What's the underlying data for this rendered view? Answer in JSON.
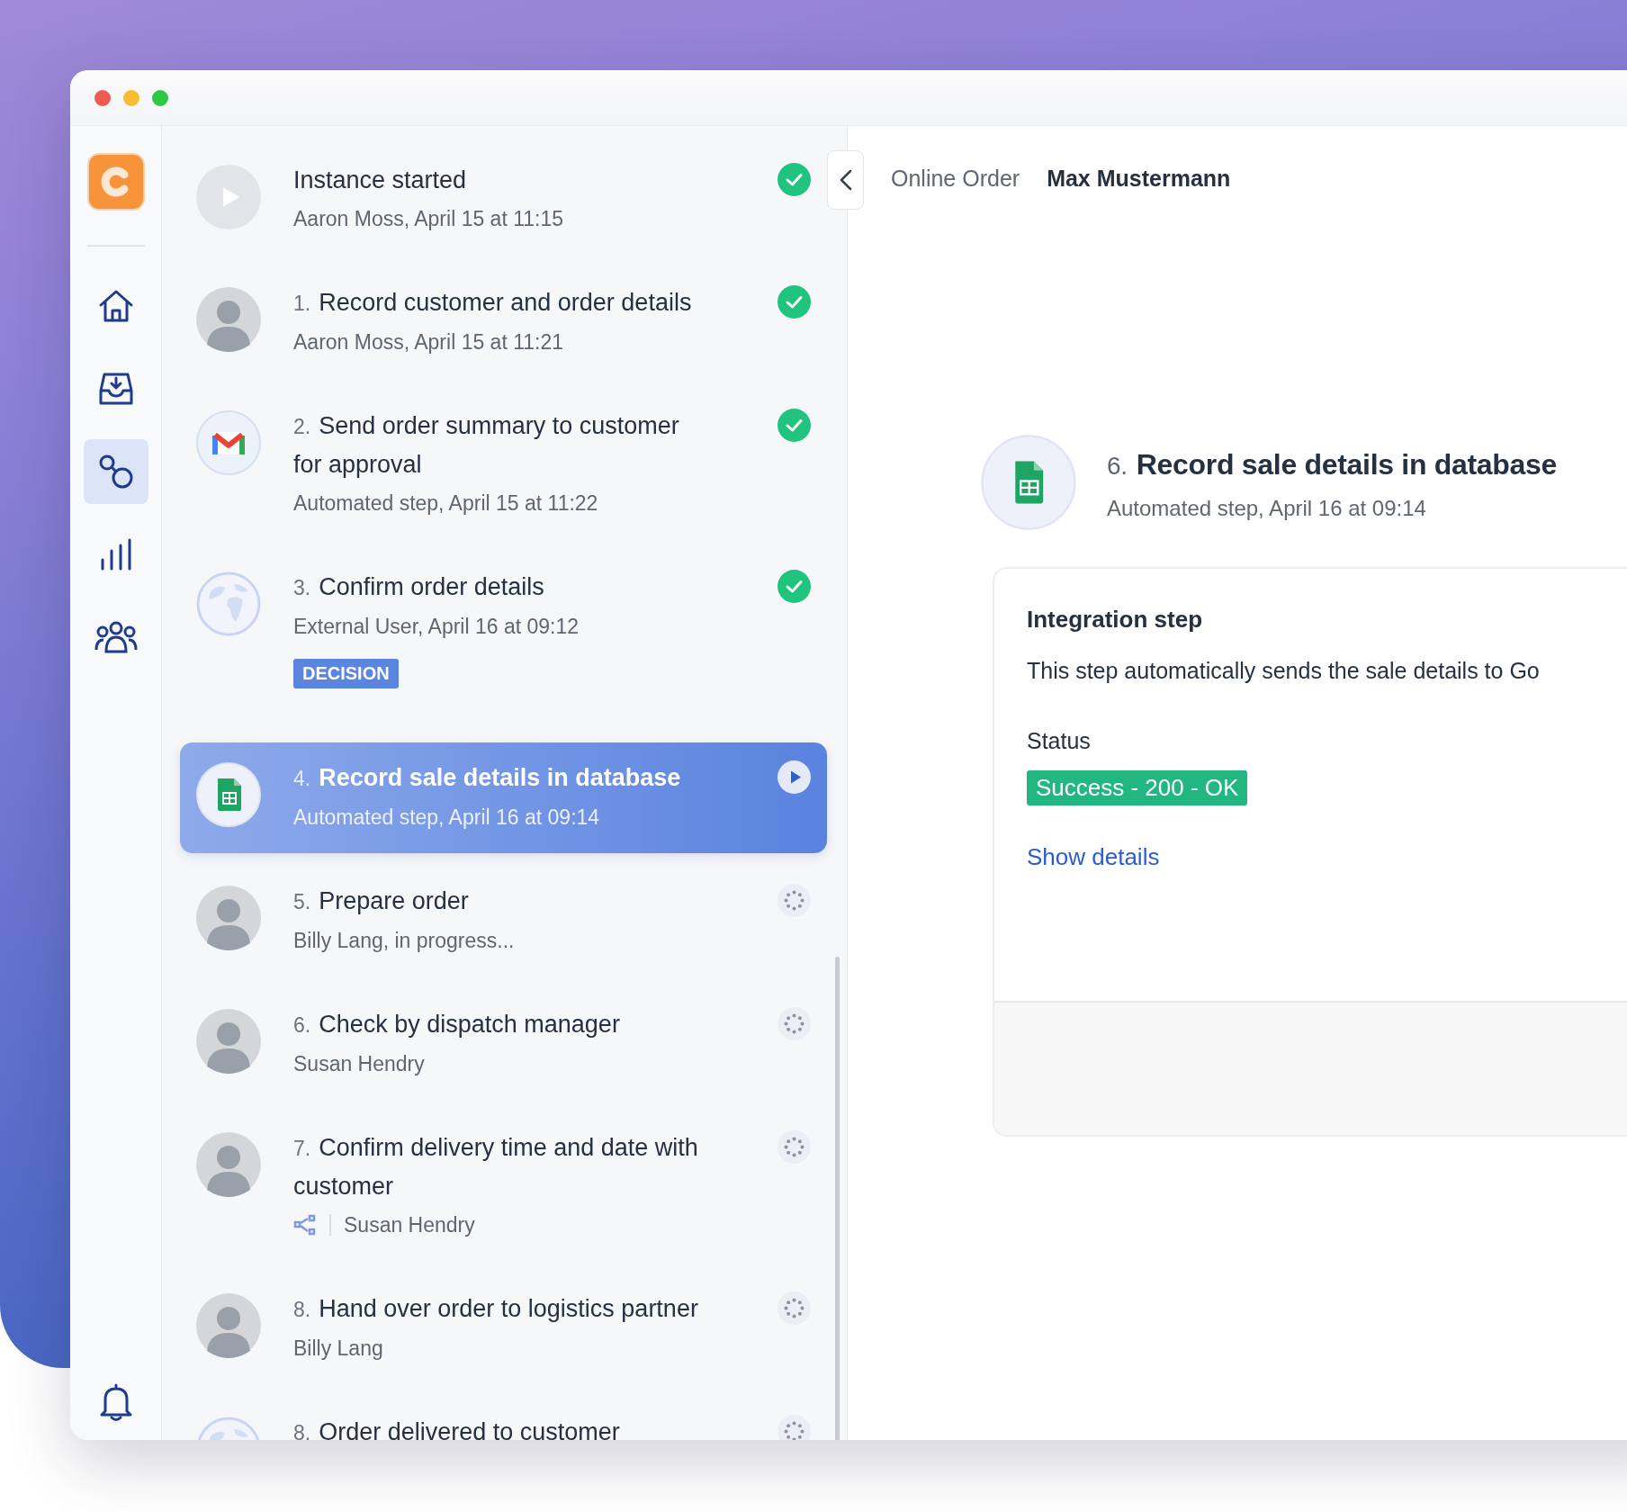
{
  "nav": {
    "items": [
      {
        "kind": "home",
        "selected": false
      },
      {
        "kind": "inbox",
        "selected": false
      },
      {
        "kind": "processes",
        "selected": true
      },
      {
        "kind": "reports",
        "selected": false
      },
      {
        "kind": "team",
        "selected": false
      }
    ]
  },
  "steps": [
    {
      "title": "Instance started",
      "subtitle": "Aaron Moss, April 15 at 11:15",
      "avatar": {
        "kind": "start"
      },
      "status": {
        "kind": "done"
      },
      "selected": false
    },
    {
      "number": "1.",
      "title": "Record customer and order details",
      "subtitle": "Aaron Moss, April 15 at 11:21",
      "avatar": {
        "kind": "person"
      },
      "status": {
        "kind": "done"
      },
      "selected": false
    },
    {
      "number": "2.",
      "title": "Send order summary to customer for approval",
      "subtitle": "Automated step, April 15 at 11:22",
      "avatar": {
        "kind": "mail"
      },
      "status": {
        "kind": "done"
      },
      "selected": false
    },
    {
      "number": "3.",
      "title": "Confirm order details",
      "subtitle": "External User, April 16 at 09:12",
      "avatar": {
        "kind": "globe"
      },
      "status": {
        "kind": "done"
      },
      "selected": false,
      "badge": "DECISION"
    },
    {
      "number": "4.",
      "title": "Record sale details in database",
      "subtitle": "Automated step, April 16 at 09:14",
      "avatar": {
        "kind": "sheet"
      },
      "status": {
        "kind": "running"
      },
      "selected": true
    },
    {
      "number": "5.",
      "title": "Prepare order",
      "subtitle": "Billy Lang, in progress...",
      "avatar": {
        "kind": "person"
      },
      "status": {
        "kind": "pending"
      },
      "selected": false
    },
    {
      "number": "6.",
      "title": "Check by dispatch manager",
      "subtitle": "Susan Hendry",
      "avatar": {
        "kind": "person"
      },
      "status": {
        "kind": "pending"
      },
      "selected": false
    },
    {
      "number": "7.",
      "title": "Confirm delivery time and date with customer",
      "subtitle": "Susan Hendry",
      "avatar": {
        "kind": "person"
      },
      "status": {
        "kind": "pending"
      },
      "selected": false,
      "subprocess": true
    },
    {
      "number": "8.",
      "title": "Hand over order to logistics partner",
      "subtitle": "Billy Lang",
      "avatar": {
        "kind": "person"
      },
      "status": {
        "kind": "pending"
      },
      "selected": false
    },
    {
      "number": "8.",
      "title": "Order delivered to customer",
      "avatar": {
        "kind": "globe"
      },
      "status": {
        "kind": "pending"
      },
      "selected": false
    }
  ],
  "breadcrumb": [
    {
      "label": "Online Order",
      "current": false
    },
    {
      "label": "Max Mustermann",
      "current": true
    }
  ],
  "detail": {
    "number": "6.",
    "title": "Record sale details in database",
    "subtitle": "Automated step, April 16 at 09:14",
    "card": {
      "heading": "Integration step",
      "description": "This step automatically sends the sale details to Go",
      "status_label": "Status",
      "status_value": "Success - 200 - OK",
      "link": "Show details"
    }
  }
}
